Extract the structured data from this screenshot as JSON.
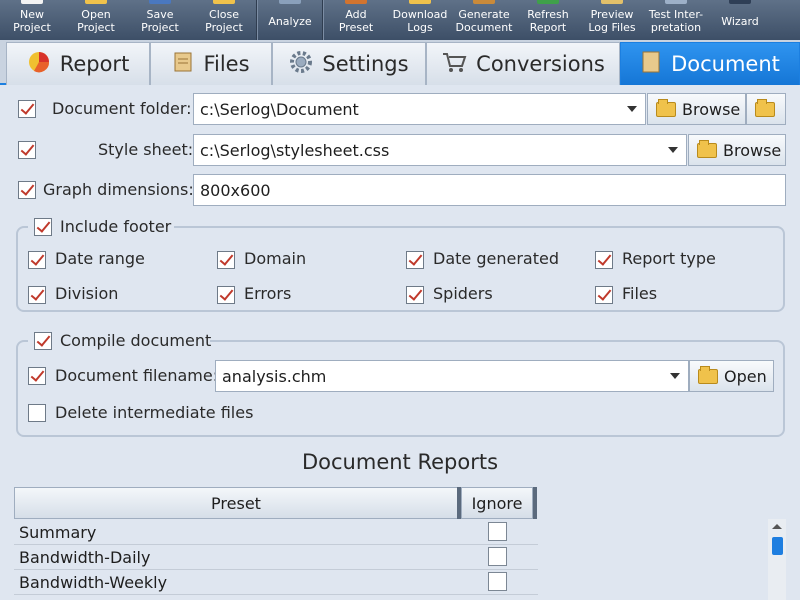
{
  "toolbar": [
    {
      "label": "New\nProject",
      "icon": "new-project-icon"
    },
    {
      "label": "Open\nProject",
      "icon": "open-project-icon"
    },
    {
      "label": "Save\nProject",
      "icon": "save-project-icon"
    },
    {
      "label": "Close\nProject",
      "icon": "close-project-icon"
    },
    {
      "label": "Analyze",
      "icon": "analyze-icon"
    },
    {
      "label": "Add\nPreset",
      "icon": "add-preset-icon"
    },
    {
      "label": "Download\nLogs",
      "icon": "download-logs-icon"
    },
    {
      "label": "Generate\nDocument",
      "icon": "generate-document-icon"
    },
    {
      "label": "Refresh\nReport",
      "icon": "refresh-report-icon"
    },
    {
      "label": "Preview\nLog Files",
      "icon": "preview-log-files-icon"
    },
    {
      "label": "Test Inter-\npretation",
      "icon": "test-interpretation-icon"
    },
    {
      "label": "Wizard",
      "icon": "wizard-icon"
    }
  ],
  "tabs": [
    {
      "label": "Report",
      "icon": "pie-chart-icon",
      "active": false
    },
    {
      "label": "Files",
      "icon": "scroll-icon",
      "active": false
    },
    {
      "label": "Settings",
      "icon": "gear-icon",
      "active": false
    },
    {
      "label": "Conversions",
      "icon": "cart-icon",
      "active": false
    },
    {
      "label": "Document",
      "icon": "document-icon",
      "active": true
    }
  ],
  "form": {
    "doc_folder_label": "Document folder:",
    "doc_folder_value": "c:\\Serlog\\Document",
    "style_sheet_label": "Style sheet:",
    "style_sheet_value": "c:\\Serlog\\stylesheet.css",
    "graph_dim_label": "Graph dimensions:",
    "graph_dim_value": "800x600",
    "browse_label": "Browse"
  },
  "footer_group": {
    "title": "Include footer",
    "options": [
      {
        "label": "Date range",
        "checked": true
      },
      {
        "label": "Domain",
        "checked": true
      },
      {
        "label": "Date generated",
        "checked": true
      },
      {
        "label": "Report type",
        "checked": true
      },
      {
        "label": "Division",
        "checked": true
      },
      {
        "label": "Errors",
        "checked": true
      },
      {
        "label": "Spiders",
        "checked": true
      },
      {
        "label": "Files",
        "checked": true
      }
    ]
  },
  "compile_group": {
    "title": "Compile document",
    "filename_label": "Document filename:",
    "filename_value": "analysis.chm",
    "open_label": "Open",
    "delete_label": "Delete intermediate files"
  },
  "reports": {
    "heading": "Document Reports",
    "col_preset": "Preset",
    "col_ignore": "Ignore",
    "rows": [
      "Summary",
      "Bandwidth-Daily",
      "Bandwidth-Weekly"
    ]
  },
  "colors": {
    "accent": "#1c7fe0",
    "check": "#c0392b"
  }
}
